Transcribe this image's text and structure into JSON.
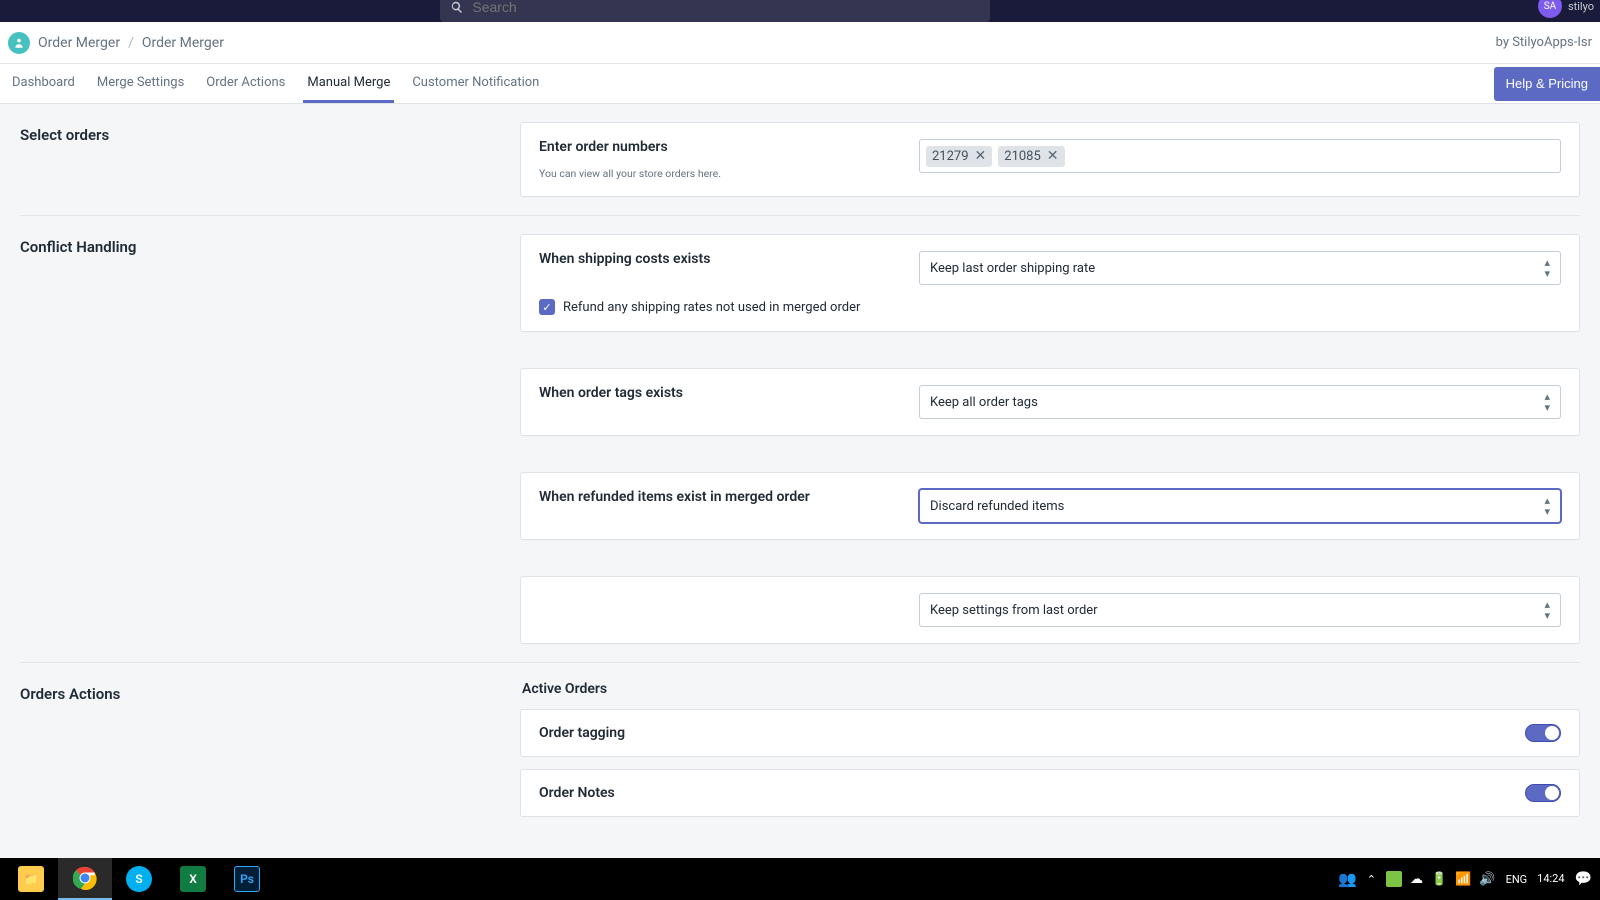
{
  "header": {
    "search_placeholder": "Search",
    "avatar_initials": "SA",
    "avatar_name": "stilyo"
  },
  "breadcrumb": {
    "app_name": "Order Merger",
    "page": "Order Merger",
    "by": "by StilyoApps-Isr"
  },
  "tabs": [
    {
      "label": "Dashboard",
      "active": false
    },
    {
      "label": "Merge Settings",
      "active": false
    },
    {
      "label": "Order Actions",
      "active": false
    },
    {
      "label": "Manual Merge",
      "active": true
    },
    {
      "label": "Customer Notification",
      "active": false
    }
  ],
  "help_button": "Help & Pricing",
  "select_orders": {
    "title": "Select orders",
    "label": "Enter order numbers",
    "helper": "You can view all your store orders here.",
    "tags": [
      "21279",
      "21085"
    ]
  },
  "conflict": {
    "title": "Conflict Handling",
    "shipping_label": "When shipping costs exists",
    "shipping_select": "Keep last order shipping rate",
    "refund_checkbox_label": "Refund any shipping rates not used in merged order",
    "refund_checked": true,
    "tags_label": "When order tags exists",
    "tags_select": "Keep all order tags",
    "refunded_label": "When refunded items exist in merged order",
    "refunded_select": "Discard refunded items",
    "settings_select": "Keep settings from last order"
  },
  "orders_actions": {
    "title": "Orders Actions",
    "active_orders": "Active Orders",
    "order_tagging": "Order tagging",
    "order_notes": "Order Notes"
  },
  "taskbar": {
    "lang": "ENG",
    "time": "14:24"
  }
}
